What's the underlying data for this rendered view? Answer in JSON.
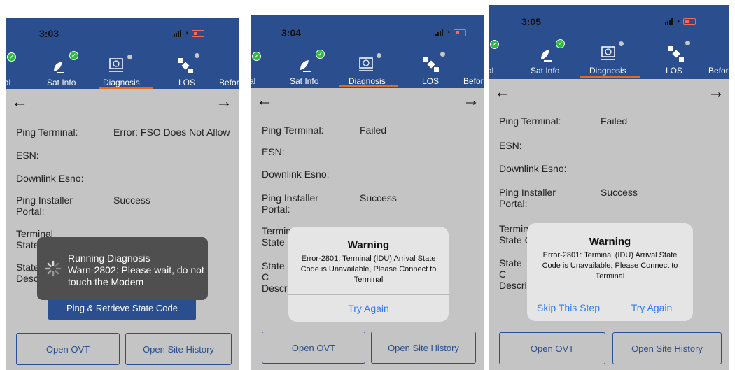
{
  "screens": [
    {
      "time": "3:03",
      "tabs": {
        "left_cut": "al",
        "sat": "Sat Info",
        "diag": "Diagnosis",
        "los": "LOS",
        "right_cut": "Befor"
      },
      "rows": [
        {
          "label": "Ping Terminal:",
          "value": "Error: FSO Does Not Allow"
        },
        {
          "label": "ESN:",
          "value": ""
        },
        {
          "label": "Downlink Esno:",
          "value": ""
        },
        {
          "label": "Ping Installer Portal:",
          "value": "Success"
        },
        {
          "label": "Terminal State",
          "value": ""
        },
        {
          "label": "State Desc",
          "value": ""
        }
      ],
      "toast": {
        "title": "Running Diagnosis",
        "message": "Warn-2802: Please wait, do not touch the Modem"
      },
      "ping_button": "Ping & Retrieve State Code",
      "buttons": {
        "ovt": "Open OVT",
        "site_history": "Open Site History"
      }
    },
    {
      "time": "3:04",
      "tabs": {
        "left_cut": "al",
        "sat": "Sat Info",
        "diag": "Diagnosis",
        "los": "LOS",
        "right_cut": "Befor"
      },
      "rows": [
        {
          "label": "Ping Terminal:",
          "value": "Failed"
        },
        {
          "label": "ESN:",
          "value": ""
        },
        {
          "label": "Downlink Esno:",
          "value": ""
        },
        {
          "label": "Ping Installer Portal:",
          "value": "Success"
        },
        {
          "label": "Termin State C",
          "value": ""
        },
        {
          "label": "State C Descri",
          "value": ""
        }
      ],
      "alert": {
        "title": "Warning",
        "message": "Error-2801: Terminal (IDU) Arrival State Code is Unavailable, Please Connect to Terminal",
        "try_again": "Try Again"
      },
      "buttons": {
        "ovt": "Open OVT",
        "site_history": "Open Site History"
      }
    },
    {
      "time": "3:05",
      "tabs": {
        "left_cut": "al",
        "sat": "Sat Info",
        "diag": "Diagnosis",
        "los": "LOS",
        "right_cut": "Befor"
      },
      "rows": [
        {
          "label": "Ping Terminal:",
          "value": "Failed"
        },
        {
          "label": "ESN:",
          "value": ""
        },
        {
          "label": "Downlink Esno:",
          "value": ""
        },
        {
          "label": "Ping Installer Portal:",
          "value": "Success"
        },
        {
          "label": "Termin State C",
          "value": ""
        },
        {
          "label": "State C Descri",
          "value": ""
        }
      ],
      "alert": {
        "title": "Warning",
        "message": "Error-2801: Terminal (IDU) Arrival State Code is Unavailable, Please Connect to Terminal",
        "skip": "Skip This Step",
        "try_again": "Try Again"
      },
      "buttons": {
        "ovt": "Open OVT",
        "site_history": "Open Site History"
      }
    }
  ]
}
